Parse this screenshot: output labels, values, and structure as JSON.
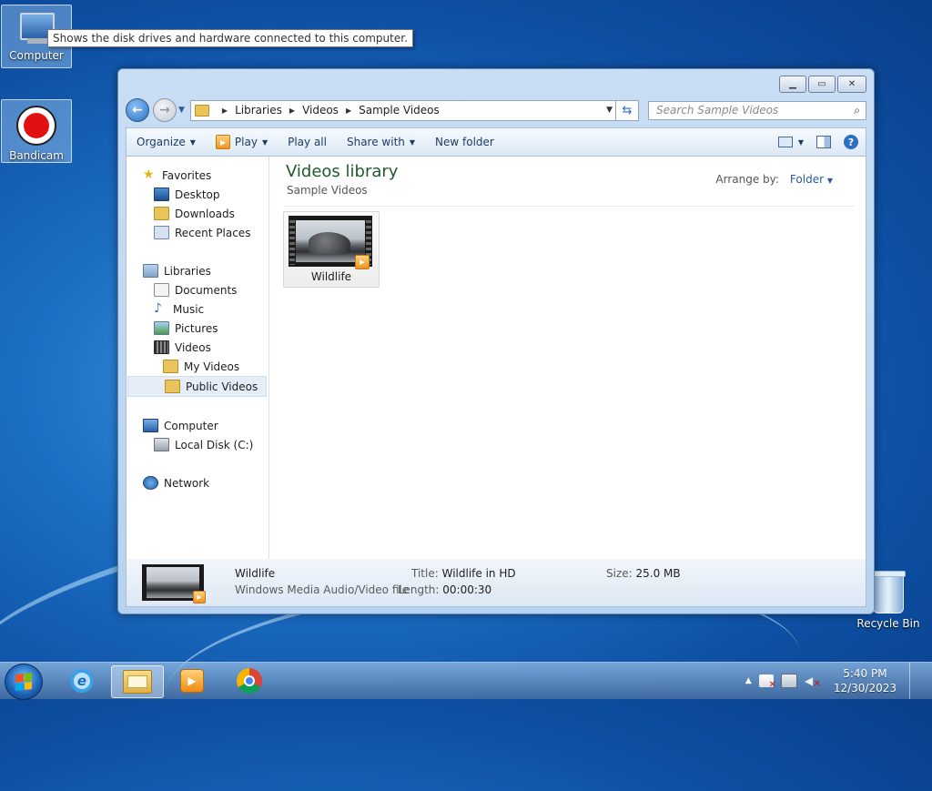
{
  "desktop": {
    "icons": [
      {
        "label": "Computer"
      },
      {
        "label": "Bandicam"
      },
      {
        "label": "Recycle Bin"
      }
    ],
    "tooltip": "Shows the disk drives and hardware connected to this computer."
  },
  "window": {
    "address": {
      "crumbs": [
        "Libraries",
        "Videos",
        "Sample Videos"
      ]
    },
    "search": {
      "placeholder": "Search Sample Videos"
    },
    "toolbar": {
      "organize": "Organize",
      "play": "Play",
      "play_all": "Play all",
      "share_with": "Share with",
      "new_folder": "New folder"
    },
    "nav": {
      "favorites": "Favorites",
      "desktop": "Desktop",
      "downloads": "Downloads",
      "recent_places": "Recent Places",
      "libraries": "Libraries",
      "documents": "Documents",
      "music": "Music",
      "pictures": "Pictures",
      "videos": "Videos",
      "my_videos": "My Videos",
      "public_videos": "Public Videos",
      "computer": "Computer",
      "local_disk": "Local Disk (C:)",
      "network": "Network"
    },
    "main": {
      "title": "Videos library",
      "subtitle": "Sample Videos",
      "arrange_label": "Arrange by:",
      "arrange_value": "Folder",
      "items": [
        {
          "label": "Wildlife"
        }
      ]
    },
    "details": {
      "name": "Wildlife",
      "type": "Windows Media Audio/Video file",
      "title_label": "Title:",
      "title_value": "Wildlife in HD",
      "length_label": "Length:",
      "length_value": "00:00:30",
      "size_label": "Size:",
      "size_value": "25.0 MB"
    }
  },
  "taskbar": {
    "apps": [
      "internet-explorer-icon",
      "windows-explorer-icon",
      "windows-media-player-icon",
      "chrome-icon"
    ],
    "time": "5:40 PM",
    "date": "12/30/2023"
  }
}
